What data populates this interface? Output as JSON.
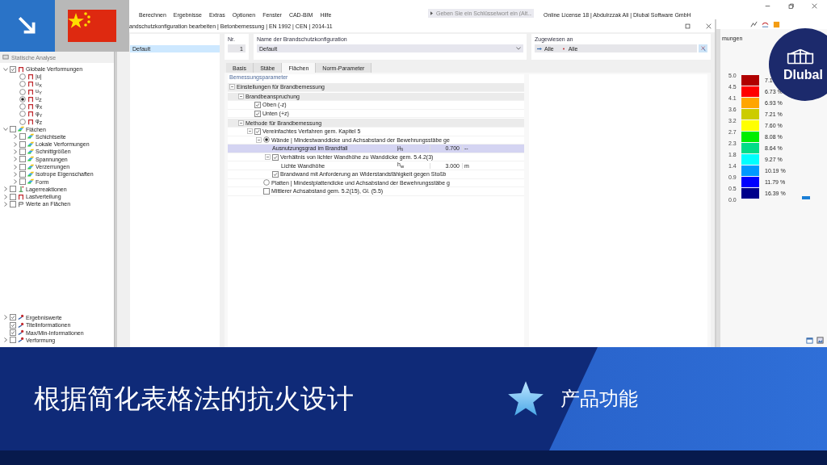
{
  "app": {
    "menu": [
      "Berechnen",
      "Ergebnisse",
      "Extras",
      "Optionen",
      "Fenster",
      "CAD-BIM",
      "Hilfe"
    ],
    "search": {
      "placeholder": "Geben Sie ein Schlüsselwort ein (Alt..."
    },
    "license": "Online License 18 | Abdulrzzak Ali | Dlubal Software GmbH"
  },
  "navigator": {
    "title": "Statische Analyse",
    "items": [
      {
        "label": "Globale Verformungen",
        "kind": "checkbox",
        "checked": true,
        "expanded": true,
        "children": [
          {
            "label": "|u|",
            "kind": "radio",
            "checked": false
          },
          {
            "label": "u$_{X}$",
            "kind": "radio",
            "checked": false
          },
          {
            "label": "u$_{Y}$",
            "kind": "radio",
            "checked": false
          },
          {
            "label": "u$_{Z}$",
            "kind": "radio",
            "checked": true
          },
          {
            "label": "φ$_{X}$",
            "kind": "radio",
            "checked": false
          },
          {
            "label": "φ$_{Y}$",
            "kind": "radio",
            "checked": false
          },
          {
            "label": "φ$_{Z}$",
            "kind": "radio",
            "checked": false
          }
        ]
      },
      {
        "label": "Flächen",
        "kind": "checkbox",
        "checked": false,
        "expanded": true,
        "children": [
          {
            "label": "Schichtseite",
            "kind": "checkbox",
            "checked": false,
            "expanded": false
          },
          {
            "label": "Lokale Verformungen",
            "kind": "checkbox",
            "checked": false,
            "expanded": false
          },
          {
            "label": "Schnittgrößen",
            "kind": "checkbox",
            "checked": false,
            "expanded": false
          },
          {
            "label": "Spannungen",
            "kind": "checkbox",
            "checked": false,
            "expanded": false
          },
          {
            "label": "Verzerrungen",
            "kind": "checkbox",
            "checked": false,
            "expanded": false
          },
          {
            "label": "Isotrope Eigenschaften",
            "kind": "checkbox",
            "checked": false,
            "expanded": false
          },
          {
            "label": "Form",
            "kind": "checkbox",
            "checked": false,
            "expanded": false
          }
        ]
      },
      {
        "label": "Lagerreaktionen",
        "kind": "checkbox",
        "checked": false,
        "expanded": false
      },
      {
        "label": "Lastverteilung",
        "kind": "checkbox",
        "checked": false,
        "expanded": false
      },
      {
        "label": "Werte an Flächen",
        "kind": "checkbox",
        "checked": false,
        "expanded": false
      }
    ],
    "display_items": [
      {
        "label": "Ergebniswerte",
        "kind": "checkbox",
        "checked": true,
        "expanded": false
      },
      {
        "label": "Titelinformationen",
        "kind": "checkbox",
        "checked": true
      },
      {
        "label": "Max/Min-Informationen",
        "kind": "checkbox",
        "checked": true
      },
      {
        "label": "Verformung",
        "kind": "checkbox",
        "checked": false,
        "expanded": false
      }
    ]
  },
  "dialog": {
    "title": "andschutzkonfiguration bearbeiten | Betonbemessung | EN 1992 | CEN | 2014-11",
    "list": [
      {
        "label": "Default",
        "selected": true
      }
    ],
    "number": {
      "label": "Nr.",
      "value": "1"
    },
    "name": {
      "label": "Name der Brandschutzkonfiguration",
      "value": "Default"
    },
    "assigned": {
      "label": "Zugewiesen an",
      "values": [
        "Alle",
        "Alle"
      ]
    },
    "tabs": [
      {
        "label": "Basis",
        "selected": false
      },
      {
        "label": "Stäbe",
        "selected": false
      },
      {
        "label": "Flächen",
        "selected": true
      },
      {
        "label": "Norm-Parameter",
        "selected": false
      }
    ],
    "section": "Bemessungsparameter",
    "params": [
      {
        "label": "Einstellungen für Brandbemessung",
        "kind": "group",
        "expanded": true,
        "selected": false,
        "children": [
          {
            "label": "Brandbeanspruchung",
            "kind": "group",
            "expanded": true,
            "selected": false,
            "children": [
              {
                "label": "Oben (-z)",
                "kind": "checkbox",
                "checked": true,
                "selected": false
              },
              {
                "label": "Unten (+z)",
                "kind": "checkbox",
                "checked": true,
                "selected": false
              }
            ]
          },
          {
            "label": "Methode für Brandbemessung",
            "kind": "group",
            "expanded": true,
            "selected": false,
            "children": [
              {
                "label": "Vereinfachtes Verfahren gem. Kapitel 5",
                "kind": "checkbox",
                "checked": true,
                "expanded": true,
                "selected": false,
                "children": [
                  {
                    "label": "Wände | Mindestwanddicke und Achsabstand der Bewehrungsstäbe ge",
                    "kind": "radio",
                    "checked": true,
                    "expanded": true,
                    "selected": false,
                    "children": [
                      {
                        "label": "Ausnutzungsgrad im Brandfall",
                        "kind": "value",
                        "symbol": "μ$_{fi}$",
                        "value": "0.700",
                        "unit": "--",
                        "selected": true
                      },
                      {
                        "label": "Verhältnis von lichter Wandhöhe zu Wanddicke gem. 5.4.2(3)",
                        "kind": "checkbox",
                        "checked": true,
                        "expanded": true,
                        "selected": false,
                        "children": [
                          {
                            "label": "Lichte Wandhöhe",
                            "kind": "value",
                            "symbol": "h$_{w}$",
                            "value": "3.000",
                            "unit": "m",
                            "selected": false
                          }
                        ]
                      },
                      {
                        "label": "Brandwand mit Anforderung an Widerstandsfähigkeit gegen Stoßb",
                        "kind": "checkbox",
                        "checked": true,
                        "selected": false
                      }
                    ]
                  },
                  {
                    "label": "Platten | Mindestplattendicke und Achsabstand der Bewehrungsstäbe g",
                    "kind": "radio",
                    "checked": false,
                    "selected": false
                  },
                  {
                    "label": "Mittlerer Achsabstand gem. 5.2(15), Gl. (5.5)",
                    "kind": "checkbox",
                    "checked": false,
                    "selected": false
                  }
                ]
              }
            ]
          }
        ]
      }
    ]
  },
  "legend": {
    "title": "mungen",
    "entries": [
      {
        "value": "5.0",
        "color": "#b00000",
        "percent": "7.1"
      },
      {
        "value": "4.5",
        "color": "#ff0000",
        "percent": "6.73 %"
      },
      {
        "value": "4.1",
        "color": "#ffa500",
        "percent": "6.93 %"
      },
      {
        "value": "3.6",
        "color": "#cccc00",
        "percent": "7.21 %"
      },
      {
        "value": "3.2",
        "color": "#ffff00",
        "percent": "7.60 %"
      },
      {
        "value": "2.7",
        "color": "#00ee00",
        "percent": "8.08 %"
      },
      {
        "value": "2.3",
        "color": "#00dd88",
        "percent": "8.64 %"
      },
      {
        "value": "1.8",
        "color": "#00ffff",
        "percent": "9.27 %"
      },
      {
        "value": "1.4",
        "color": "#0099ff",
        "percent": "10.19 %"
      },
      {
        "value": "0.9",
        "color": "#0000ff",
        "percent": "11.79 %"
      },
      {
        "value": "0.5",
        "color": "#00008b",
        "percent": "16.39 %"
      }
    ],
    "last_value": "0.0"
  },
  "banner": {
    "title": "根据简化表格法的抗火设计",
    "tag": "产品功能"
  },
  "logo": {
    "text": "Dlubal"
  }
}
